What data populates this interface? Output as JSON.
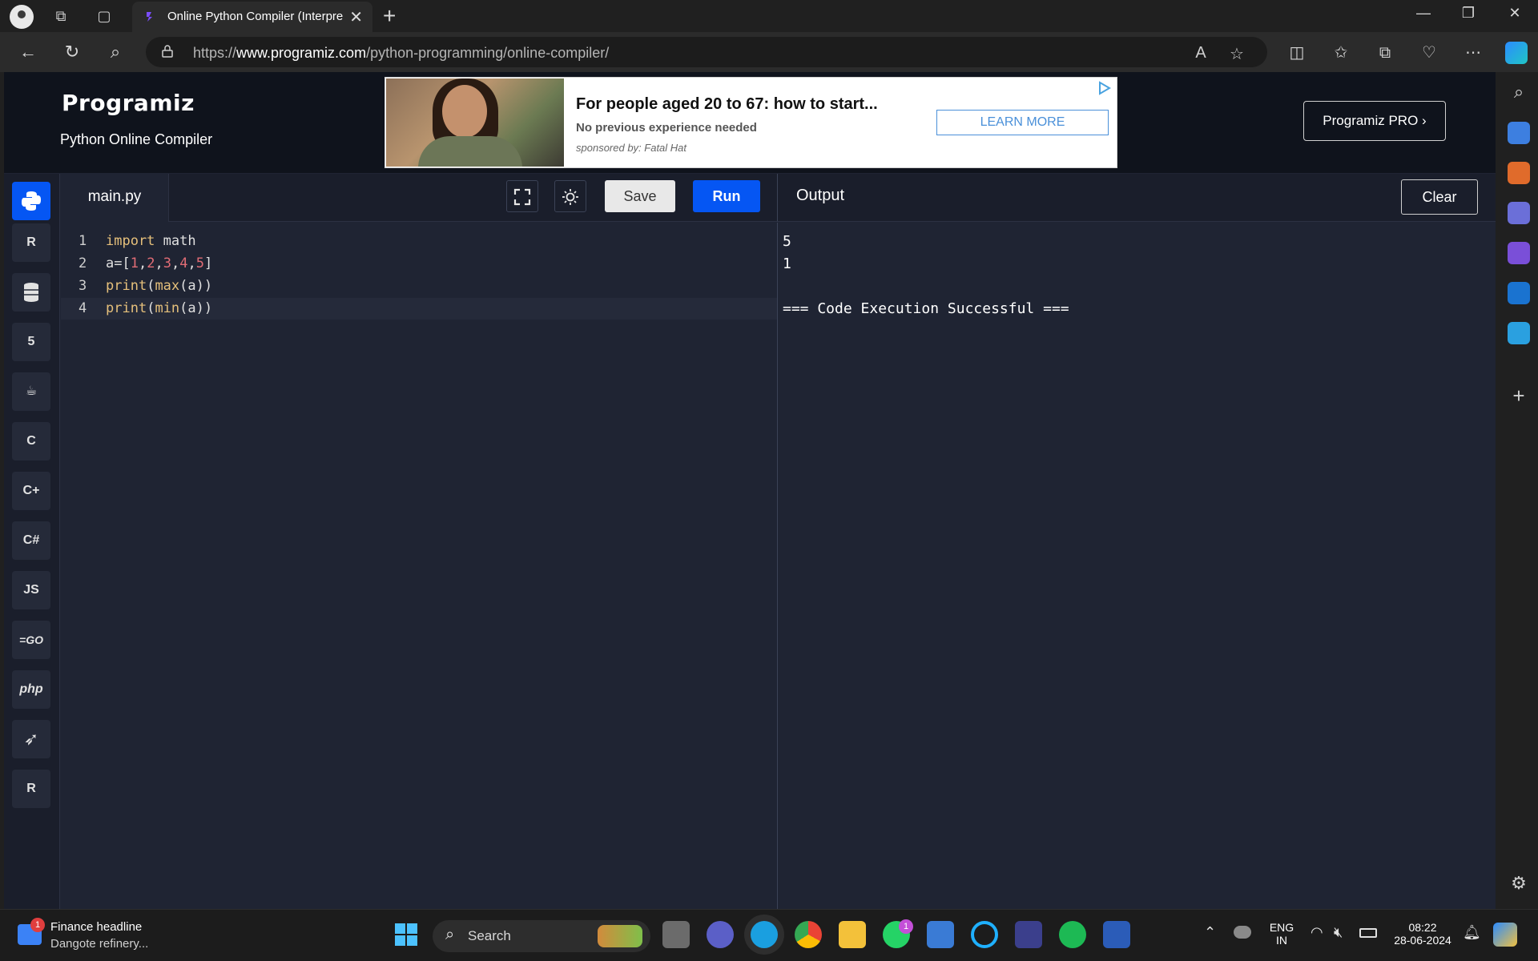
{
  "browser": {
    "tab_title": "Online Python Compiler (Interpre",
    "url_domain": "www.programiz.com",
    "url_prefix": "https://",
    "url_path": "/python-programming/online-compiler/"
  },
  "site": {
    "logo": "Programiz",
    "subtitle": "Python Online Compiler",
    "pro_button": "Programiz PRO ›"
  },
  "ad": {
    "headline": "For people aged 20 to 67: how to start...",
    "subline": "No previous experience needed",
    "sponsor": "sponsored by: Fatal Hat",
    "cta": "LEARN MORE"
  },
  "languages": [
    {
      "name": "python-lang-icon",
      "label": ""
    },
    {
      "name": "r-lang-icon",
      "label": "R"
    },
    {
      "name": "sql-lang-icon",
      "label": ""
    },
    {
      "name": "html-lang-icon",
      "label": "5"
    },
    {
      "name": "java-lang-icon",
      "label": "☕"
    },
    {
      "name": "c-lang-icon",
      "label": "C"
    },
    {
      "name": "cpp-lang-icon",
      "label": "C+"
    },
    {
      "name": "csharp-lang-icon",
      "label": "C#"
    },
    {
      "name": "js-lang-icon",
      "label": "JS"
    },
    {
      "name": "go-lang-icon",
      "label": "=GO"
    },
    {
      "name": "php-lang-icon",
      "label": "php"
    },
    {
      "name": "swift-lang-icon",
      "label": "➶"
    },
    {
      "name": "rust-lang-icon",
      "label": "R"
    }
  ],
  "editor": {
    "file_name": "main.py",
    "save_label": "Save",
    "run_label": "Run",
    "line_numbers": [
      "1",
      "2",
      "3",
      "4"
    ]
  },
  "output": {
    "title": "Output",
    "clear_label": "Clear",
    "lines": [
      "5",
      "1",
      "",
      "=== Code Execution Successful ==="
    ]
  },
  "taskbar": {
    "news_title": "Finance headline",
    "news_sub": "Dangote refinery...",
    "news_badge": "1",
    "search_label": "Search",
    "whatsapp_badge": "1",
    "lang_top": "ENG",
    "lang_bottom": "IN",
    "time": "08:22",
    "date": "28-06-2024"
  }
}
